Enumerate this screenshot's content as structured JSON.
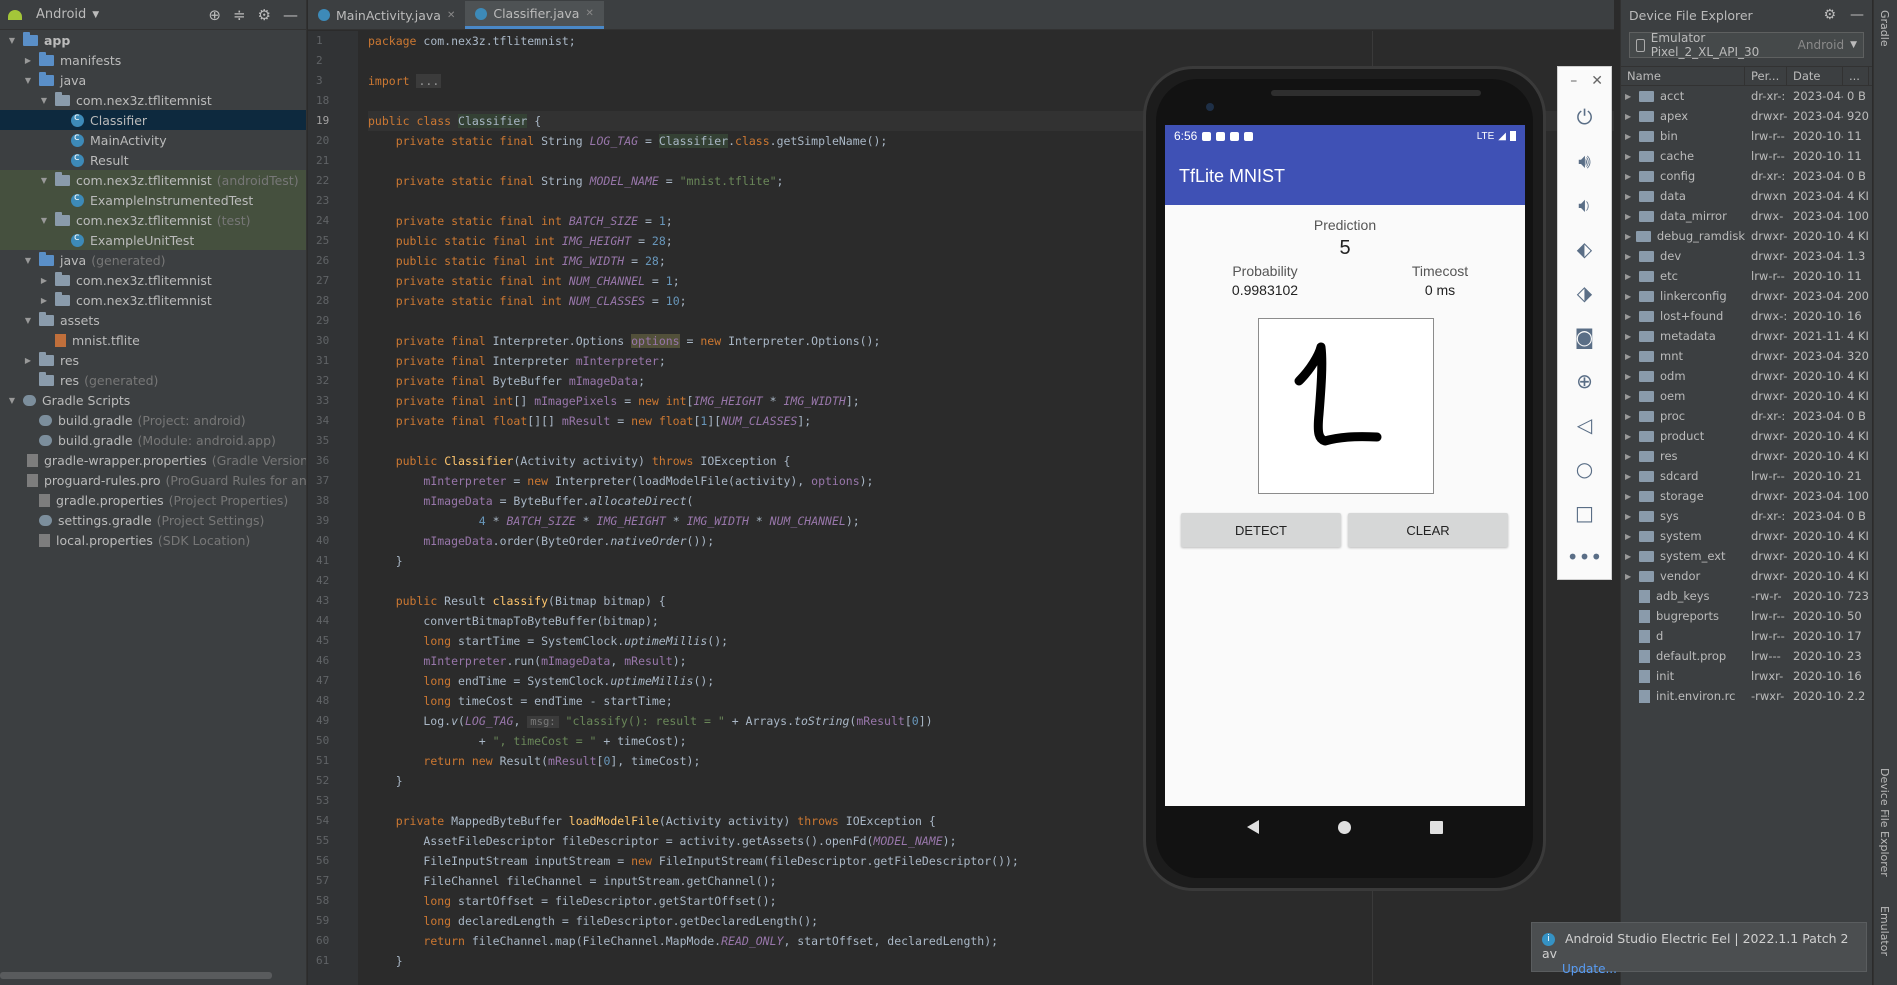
{
  "project_panel": {
    "view_label": "Android",
    "tree": [
      {
        "label": "app",
        "indent": 0,
        "arrow": "down",
        "icon": "folder-blue",
        "bold": true
      },
      {
        "label": "manifests",
        "indent": 1,
        "arrow": "right",
        "icon": "folder-blue"
      },
      {
        "label": "java",
        "indent": 1,
        "arrow": "down",
        "icon": "folder-blue"
      },
      {
        "label": "com.nex3z.tflitemnist",
        "indent": 2,
        "arrow": "down",
        "icon": "folder"
      },
      {
        "label": "Classifier",
        "indent": 3,
        "arrow": "",
        "icon": "class",
        "selected": true
      },
      {
        "label": "MainActivity",
        "indent": 3,
        "arrow": "",
        "icon": "class"
      },
      {
        "label": "Result",
        "indent": 3,
        "arrow": "",
        "icon": "class"
      },
      {
        "label": "com.nex3z.tflitemnist",
        "hint": "(androidTest)",
        "indent": 2,
        "arrow": "down",
        "icon": "folder",
        "test": true
      },
      {
        "label": "ExampleInstrumentedTest",
        "indent": 3,
        "arrow": "",
        "icon": "class",
        "test": true
      },
      {
        "label": "com.nex3z.tflitemnist",
        "hint": "(test)",
        "indent": 2,
        "arrow": "down",
        "icon": "folder",
        "test": true
      },
      {
        "label": "ExampleUnitTest",
        "indent": 3,
        "arrow": "",
        "icon": "class",
        "test": true
      },
      {
        "label": "java",
        "hint": "(generated)",
        "indent": 1,
        "arrow": "down",
        "icon": "folder-blue"
      },
      {
        "label": "com.nex3z.tflitemnist",
        "indent": 2,
        "arrow": "right",
        "icon": "folder"
      },
      {
        "label": "com.nex3z.tflitemnist",
        "indent": 2,
        "arrow": "right",
        "icon": "folder"
      },
      {
        "label": "assets",
        "indent": 1,
        "arrow": "down",
        "icon": "folder"
      },
      {
        "label": "mnist.tflite",
        "indent": 2,
        "arrow": "",
        "icon": "file-tflite"
      },
      {
        "label": "res",
        "indent": 1,
        "arrow": "right",
        "icon": "folder"
      },
      {
        "label": "res",
        "hint": "(generated)",
        "indent": 1,
        "arrow": "",
        "icon": "folder"
      },
      {
        "label": "Gradle Scripts",
        "indent": 0,
        "arrow": "down",
        "icon": "gradle"
      },
      {
        "label": "build.gradle",
        "hint": "(Project: android)",
        "indent": 1,
        "arrow": "",
        "icon": "gradle"
      },
      {
        "label": "build.gradle",
        "hint": "(Module: android.app)",
        "indent": 1,
        "arrow": "",
        "icon": "gradle"
      },
      {
        "label": "gradle-wrapper.properties",
        "hint": "(Gradle Version)",
        "indent": 1,
        "arrow": "",
        "icon": "file"
      },
      {
        "label": "proguard-rules.pro",
        "hint": "(ProGuard Rules for androi",
        "indent": 1,
        "arrow": "",
        "icon": "file"
      },
      {
        "label": "gradle.properties",
        "hint": "(Project Properties)",
        "indent": 1,
        "arrow": "",
        "icon": "file"
      },
      {
        "label": "settings.gradle",
        "hint": "(Project Settings)",
        "indent": 1,
        "arrow": "",
        "icon": "gradle"
      },
      {
        "label": "local.properties",
        "hint": "(SDK Location)",
        "indent": 1,
        "arrow": "",
        "icon": "file"
      }
    ]
  },
  "editor": {
    "tabs": [
      {
        "label": "MainActivity.java",
        "active": false
      },
      {
        "label": "Classifier.java",
        "active": true
      }
    ],
    "line_numbers": [
      "1",
      "2",
      "3",
      "18",
      "19",
      "20",
      "21",
      "22",
      "23",
      "24",
      "25",
      "26",
      "27",
      "28",
      "29",
      "30",
      "31",
      "32",
      "33",
      "34",
      "35",
      "36",
      "37",
      "38",
      "39",
      "40",
      "41",
      "42",
      "43",
      "44",
      "45",
      "46",
      "47",
      "48",
      "49",
      "50",
      "51",
      "52",
      "53",
      "54",
      "55",
      "56",
      "57",
      "58",
      "59",
      "60",
      "61"
    ],
    "current_line": "19"
  },
  "emulator": {
    "status_time": "6:56",
    "status_net": "LTE",
    "app_title": "TfLite MNIST",
    "prediction_label": "Prediction",
    "prediction_value": "5",
    "probability_label": "Probability",
    "probability_value": "0.9983102",
    "timecost_label": "Timecost",
    "timecost_value": "0 ms",
    "detect_label": "DETECT",
    "clear_label": "CLEAR",
    "toolbar_icons": [
      "power-icon",
      "volume-up-icon",
      "volume-down-icon",
      "rotate-left-icon",
      "rotate-right-icon",
      "camera-icon",
      "zoom-icon",
      "back-icon",
      "home-icon",
      "overview-icon",
      "more-icon"
    ]
  },
  "device_explorer": {
    "title": "Device File Explorer",
    "device": "Emulator Pixel_2_XL_API_30",
    "device_hint": "Android",
    "columns": [
      "Name",
      "Per...",
      "Date",
      "..."
    ],
    "rows": [
      {
        "name": "acct",
        "type": "dir",
        "perm": "dr-xr-:",
        "date": "2023-04-",
        "size": "0 B"
      },
      {
        "name": "apex",
        "type": "dir",
        "perm": "drwxr-",
        "date": "2023-04-",
        "size": "920"
      },
      {
        "name": "bin",
        "type": "dir",
        "perm": "lrw-r--",
        "date": "2020-10-",
        "size": "11"
      },
      {
        "name": "cache",
        "type": "dir",
        "perm": "lrw-r--",
        "date": "2020-10-",
        "size": "11"
      },
      {
        "name": "config",
        "type": "dir",
        "perm": "dr-xr-:",
        "date": "2023-04-",
        "size": "0 B"
      },
      {
        "name": "data",
        "type": "dir",
        "perm": "drwxn",
        "date": "2023-04-",
        "size": "4 KI"
      },
      {
        "name": "data_mirror",
        "type": "dir",
        "perm": "drwx-",
        "date": "2023-04-",
        "size": "100"
      },
      {
        "name": "debug_ramdisk",
        "type": "dir",
        "perm": "drwxr-",
        "date": "2020-10-",
        "size": "4 KI"
      },
      {
        "name": "dev",
        "type": "dir",
        "perm": "drwxr-",
        "date": "2023-04-",
        "size": "1.3"
      },
      {
        "name": "etc",
        "type": "dir",
        "perm": "lrw-r--",
        "date": "2020-10-",
        "size": "11"
      },
      {
        "name": "linkerconfig",
        "type": "dir",
        "perm": "drwxr-",
        "date": "2023-04-",
        "size": "200"
      },
      {
        "name": "lost+found",
        "type": "dir",
        "perm": "drwx-:",
        "date": "2020-10-",
        "size": "16"
      },
      {
        "name": "metadata",
        "type": "dir",
        "perm": "drwxr-",
        "date": "2021-11-",
        "size": "4 KI"
      },
      {
        "name": "mnt",
        "type": "dir",
        "perm": "drwxr-",
        "date": "2023-04-",
        "size": "320"
      },
      {
        "name": "odm",
        "type": "dir",
        "perm": "drwxr-",
        "date": "2020-10-",
        "size": "4 KI"
      },
      {
        "name": "oem",
        "type": "dir",
        "perm": "drwxr-",
        "date": "2020-10-",
        "size": "4 KI"
      },
      {
        "name": "proc",
        "type": "dir",
        "perm": "dr-xr-:",
        "date": "2023-04-",
        "size": "0 B"
      },
      {
        "name": "product",
        "type": "dir",
        "perm": "drwxr-",
        "date": "2020-10-",
        "size": "4 KI"
      },
      {
        "name": "res",
        "type": "dir",
        "perm": "drwxr-",
        "date": "2020-10-",
        "size": "4 KI"
      },
      {
        "name": "sdcard",
        "type": "dir",
        "perm": "lrw-r--",
        "date": "2020-10-",
        "size": "21"
      },
      {
        "name": "storage",
        "type": "dir",
        "perm": "drwxr-",
        "date": "2023-04-",
        "size": "100"
      },
      {
        "name": "sys",
        "type": "dir",
        "perm": "dr-xr-:",
        "date": "2023-04-",
        "size": "0 B"
      },
      {
        "name": "system",
        "type": "dir",
        "perm": "drwxr-",
        "date": "2020-10-",
        "size": "4 KI"
      },
      {
        "name": "system_ext",
        "type": "dir",
        "perm": "drwxr-",
        "date": "2020-10-",
        "size": "4 KI"
      },
      {
        "name": "vendor",
        "type": "dir",
        "perm": "drwxr-",
        "date": "2020-10-",
        "size": "4 KI"
      },
      {
        "name": "adb_keys",
        "type": "file",
        "perm": "-rw-r-",
        "date": "2020-10-",
        "size": "723"
      },
      {
        "name": "bugreports",
        "type": "file",
        "perm": "lrw-r--",
        "date": "2020-10-",
        "size": "50"
      },
      {
        "name": "d",
        "type": "file",
        "perm": "lrw-r--",
        "date": "2020-10-",
        "size": "17"
      },
      {
        "name": "default.prop",
        "type": "file",
        "perm": "lrw---",
        "date": "2020-10-",
        "size": "23"
      },
      {
        "name": "init",
        "type": "file",
        "perm": "lrwxr-",
        "date": "2020-10-",
        "size": "16"
      },
      {
        "name": "init.environ.rc",
        "type": "file",
        "perm": "-rwxr-",
        "date": "2020-10-",
        "size": "2.2"
      }
    ]
  },
  "right_strip": {
    "gradle": "Gradle",
    "device_explorer": "Device File Explorer",
    "emulator": "Emulator"
  },
  "notification": {
    "title": "Android Studio Electric Eel | 2022.1.1 Patch 2 av",
    "action": "Update..."
  }
}
